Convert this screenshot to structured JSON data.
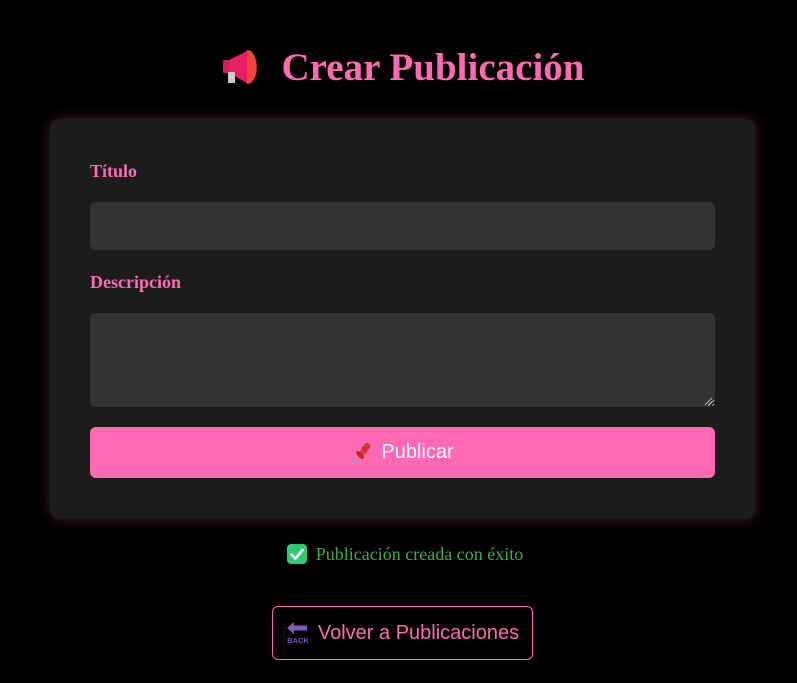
{
  "header": {
    "icon": "megaphone-icon",
    "title": "Crear Publicación"
  },
  "form": {
    "title_label": "Título",
    "title_value": "",
    "title_placeholder": "",
    "description_label": "Descripción",
    "description_value": "",
    "description_placeholder": "",
    "submit_icon": "pushpin-icon",
    "submit_label": "Publicar"
  },
  "status": {
    "icon": "check-icon",
    "message": "Publicación creada con éxito"
  },
  "navigation": {
    "back_icon": "back-arrow-icon",
    "back_label": "Volver a Publicaciones"
  },
  "colors": {
    "accent": "#ff69b4",
    "background": "#000000",
    "card": "#1c1c1c",
    "input": "#333333",
    "success": "#3cb043"
  }
}
